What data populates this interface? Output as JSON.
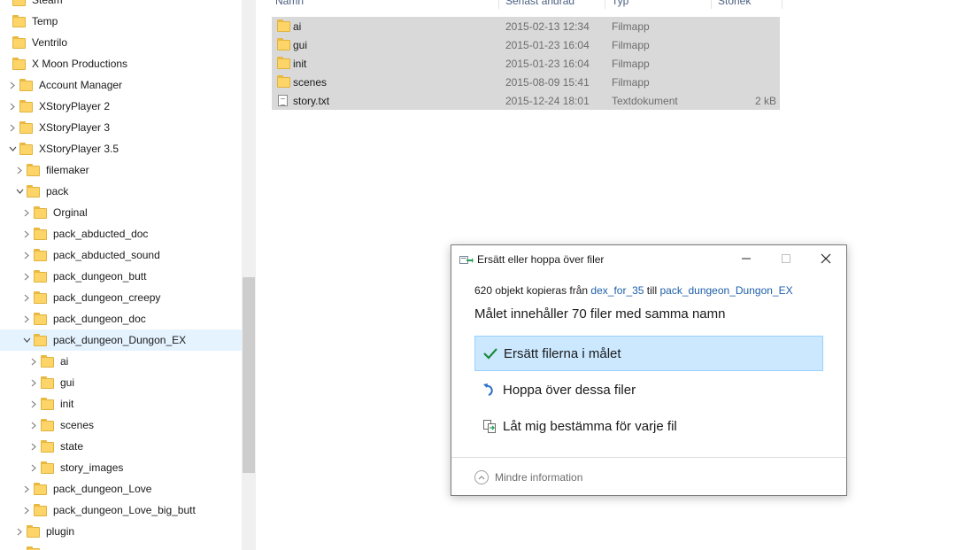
{
  "nav": {
    "items": [
      {
        "label": "Steam",
        "indent": 0,
        "expand": "none"
      },
      {
        "label": "Temp",
        "indent": 0,
        "expand": "none"
      },
      {
        "label": "Ventrilo",
        "indent": 0,
        "expand": "none"
      },
      {
        "label": "X Moon Productions",
        "indent": 0,
        "expand": "none"
      },
      {
        "label": "Account Manager",
        "indent": 1,
        "expand": "collapsed"
      },
      {
        "label": "XStoryPlayer 2",
        "indent": 1,
        "expand": "collapsed"
      },
      {
        "label": "XStoryPlayer 3",
        "indent": 1,
        "expand": "collapsed"
      },
      {
        "label": "XStoryPlayer 3.5",
        "indent": 1,
        "expand": "expanded"
      },
      {
        "label": "filemaker",
        "indent": 2,
        "expand": "collapsed"
      },
      {
        "label": "pack",
        "indent": 2,
        "expand": "expanded"
      },
      {
        "label": "Orginal",
        "indent": 3,
        "expand": "collapsed"
      },
      {
        "label": "pack_abducted_doc",
        "indent": 3,
        "expand": "collapsed"
      },
      {
        "label": "pack_abducted_sound",
        "indent": 3,
        "expand": "collapsed"
      },
      {
        "label": "pack_dungeon_butt",
        "indent": 3,
        "expand": "collapsed"
      },
      {
        "label": "pack_dungeon_creepy",
        "indent": 3,
        "expand": "collapsed"
      },
      {
        "label": "pack_dungeon_doc",
        "indent": 3,
        "expand": "collapsed"
      },
      {
        "label": "pack_dungeon_Dungon_EX",
        "indent": 3,
        "expand": "expanded",
        "selected": true
      },
      {
        "label": "ai",
        "indent": 4,
        "expand": "collapsed"
      },
      {
        "label": "gui",
        "indent": 4,
        "expand": "collapsed"
      },
      {
        "label": "init",
        "indent": 4,
        "expand": "collapsed"
      },
      {
        "label": "scenes",
        "indent": 4,
        "expand": "collapsed"
      },
      {
        "label": "state",
        "indent": 4,
        "expand": "collapsed"
      },
      {
        "label": "story_images",
        "indent": 4,
        "expand": "collapsed"
      },
      {
        "label": "pack_dungeon_Love",
        "indent": 3,
        "expand": "collapsed"
      },
      {
        "label": "pack_dungeon_Love_big_butt",
        "indent": 3,
        "expand": "collapsed"
      },
      {
        "label": "plugin",
        "indent": 2,
        "expand": "collapsed"
      },
      {
        "label": "",
        "indent": 2,
        "expand": "none"
      }
    ]
  },
  "files": {
    "columns": {
      "name": "Namn",
      "date": "Senast ändrad",
      "type": "Typ",
      "size": "Storlek"
    },
    "rows": [
      {
        "name": "ai",
        "date": "2015-02-13 12:34",
        "type": "Filmapp",
        "size": "",
        "icon": "folder-icon"
      },
      {
        "name": "gui",
        "date": "2015-01-23 16:04",
        "type": "Filmapp",
        "size": "",
        "icon": "folder-icon"
      },
      {
        "name": "init",
        "date": "2015-01-23 16:04",
        "type": "Filmapp",
        "size": "",
        "icon": "folder-icon"
      },
      {
        "name": "scenes",
        "date": "2015-08-09 15:41",
        "type": "Filmapp",
        "size": "",
        "icon": "folder-icon"
      },
      {
        "name": "story.txt",
        "date": "2015-12-24 18:01",
        "type": "Textdokument",
        "size": "2 kB",
        "icon": "text-file-icon"
      }
    ]
  },
  "dialog": {
    "title": "Ersätt eller hoppa över filer",
    "info_prefix": "620 objekt kopieras från ",
    "info_source": "dex_for_35",
    "info_mid": " till ",
    "info_dest": "pack_dungeon_Dungon_EX",
    "heading": "Målet innehåller 70 filer med samma namn",
    "options": {
      "replace": "Ersätt filerna i målet",
      "skip": "Hoppa över dessa filer",
      "decide": "Låt mig bestämma för varje fil"
    },
    "footer": "Mindre information",
    "colors": {
      "selected_bg": "#cce8ff",
      "link": "#1e5fa8"
    }
  }
}
